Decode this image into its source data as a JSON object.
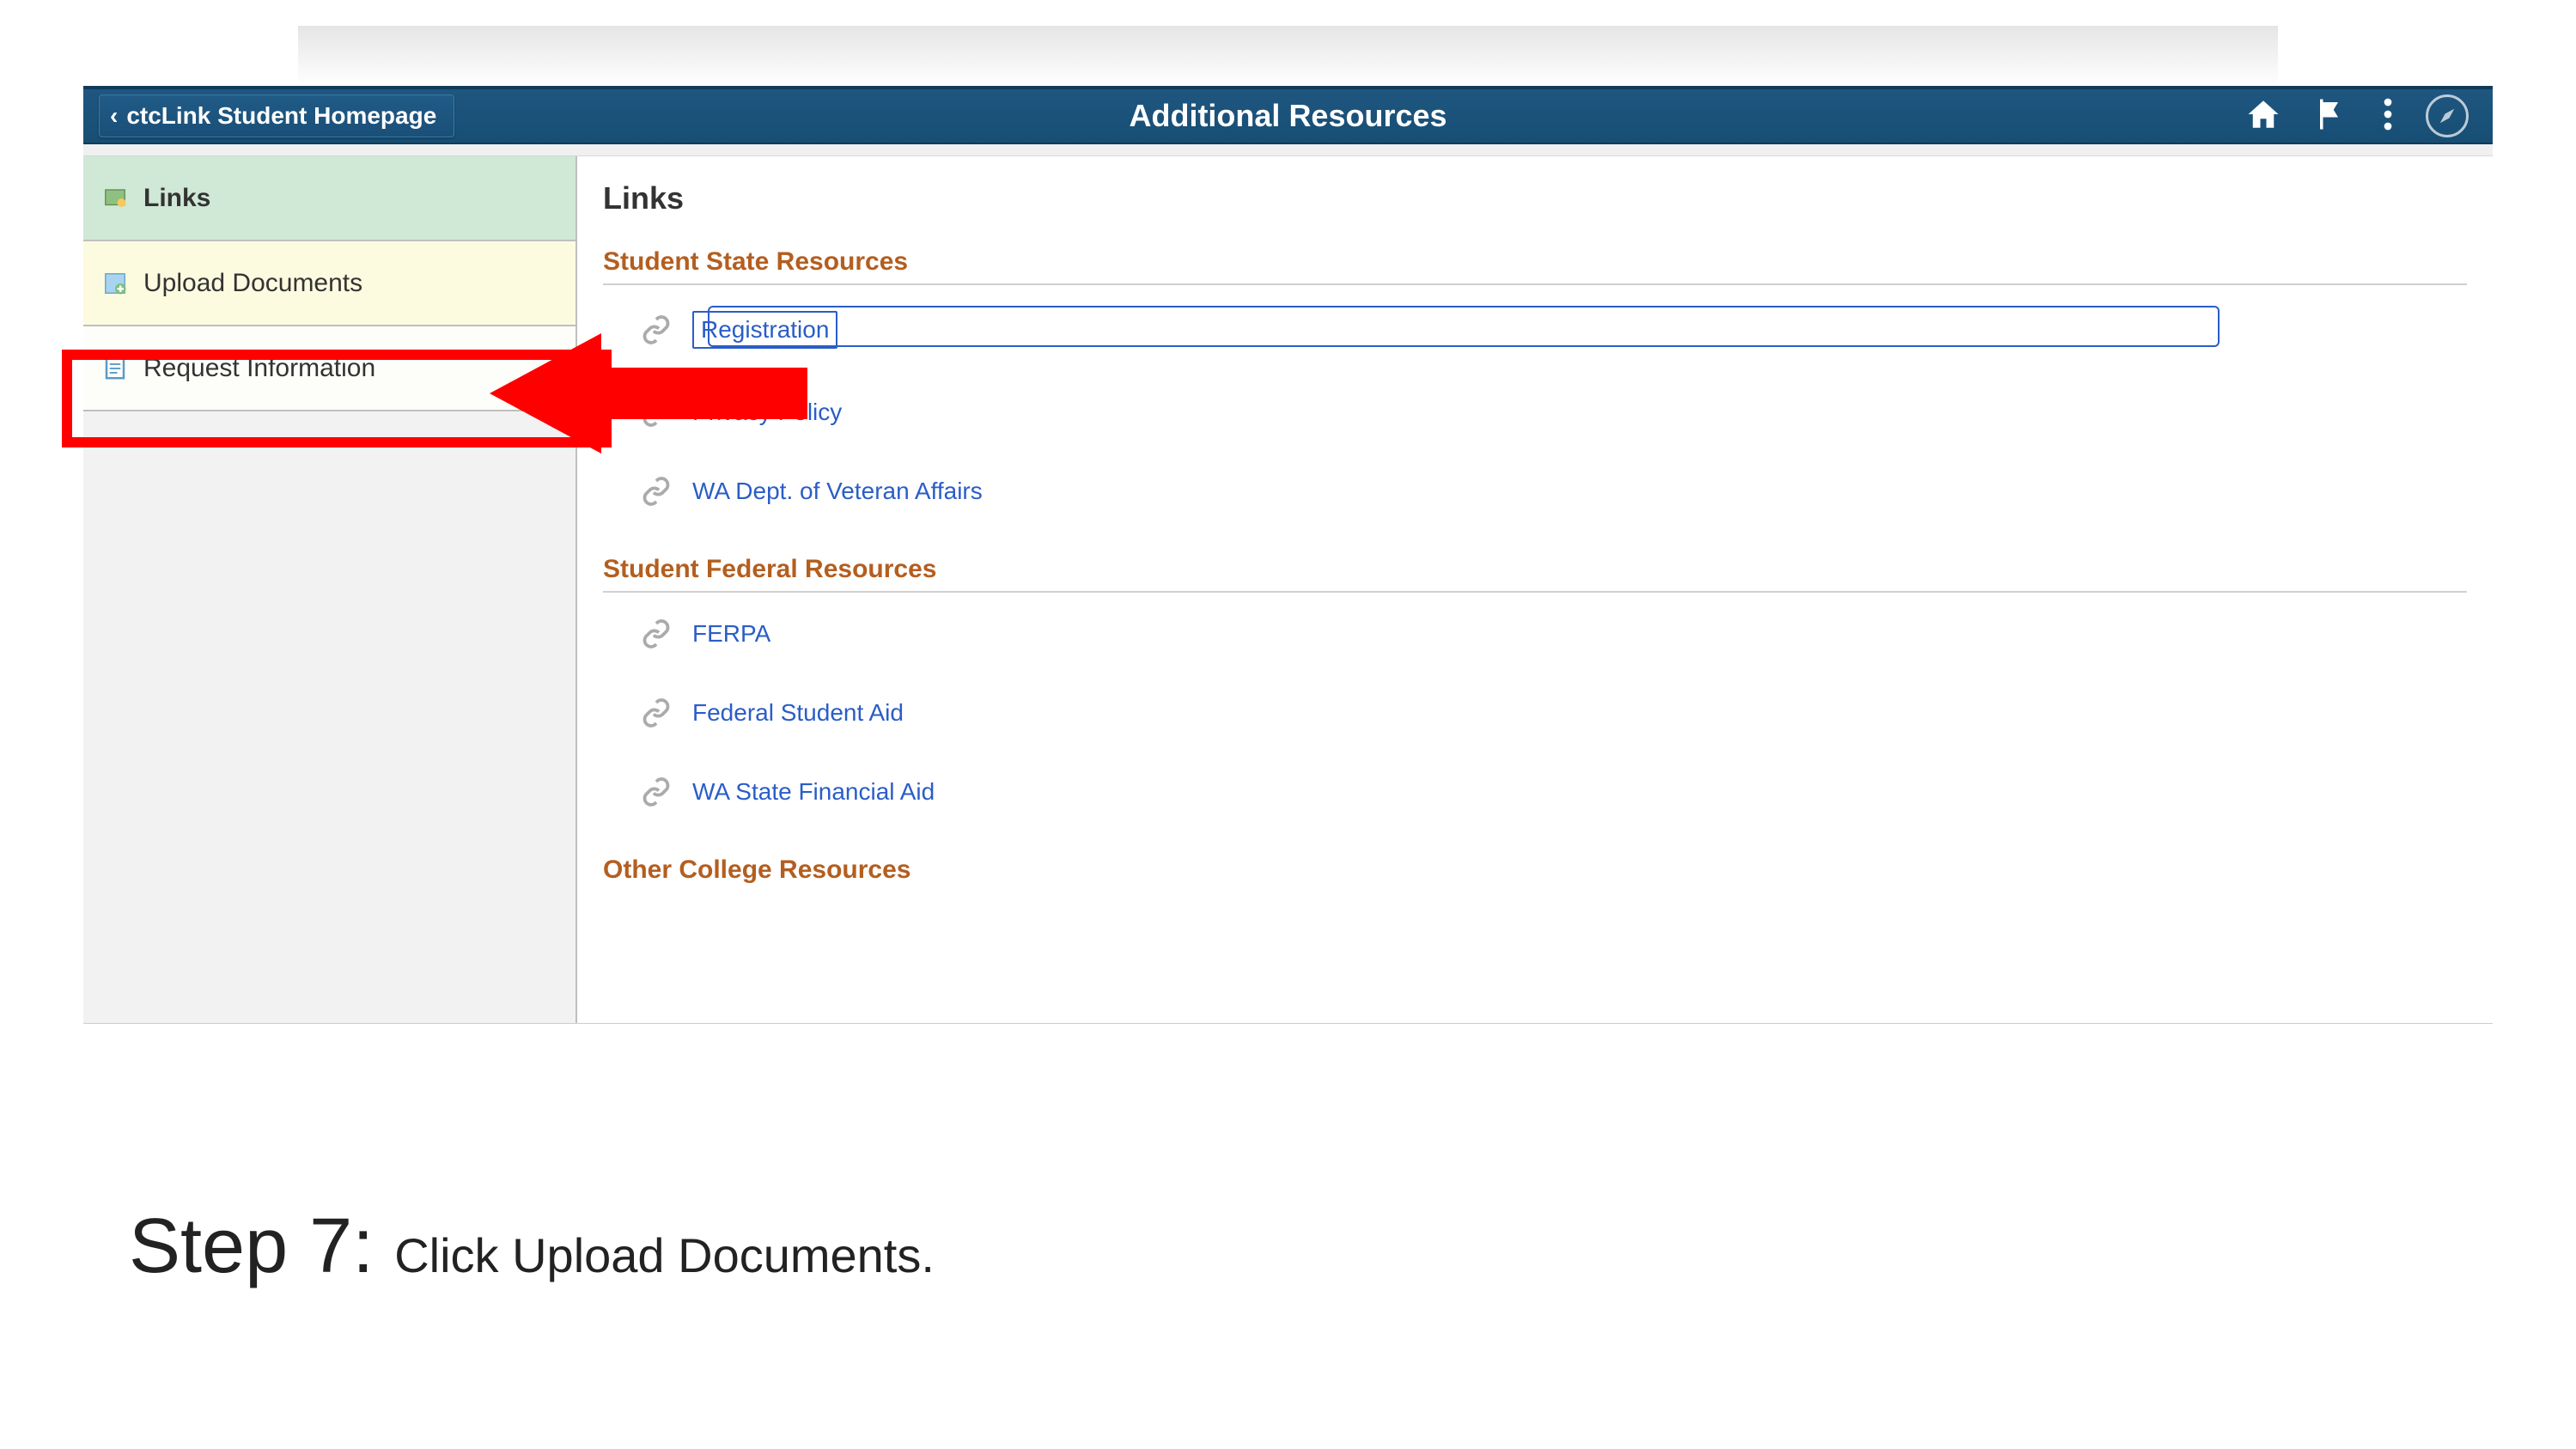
{
  "header": {
    "back_label": "ctcLink Student Homepage",
    "title": "Additional Resources"
  },
  "sidebar": {
    "items": [
      {
        "label": "Links",
        "icon": "links-icon",
        "active": true
      },
      {
        "label": "Upload Documents",
        "icon": "upload-icon",
        "highlighted": true
      },
      {
        "label": "Request Information",
        "icon": "request-icon"
      }
    ]
  },
  "main": {
    "title": "Links",
    "sections": [
      {
        "title": "Student State Resources",
        "links": [
          {
            "label": "Registration",
            "selected": true
          },
          {
            "label": "Privacy Policy"
          },
          {
            "label": "WA Dept. of Veteran Affairs"
          }
        ]
      },
      {
        "title": "Student Federal Resources",
        "links": [
          {
            "label": "FERPA"
          },
          {
            "label": "Federal Student Aid"
          },
          {
            "label": "WA State Financial Aid"
          }
        ]
      },
      {
        "title": "Other College Resources",
        "partial": true,
        "links": []
      }
    ]
  },
  "annotation": {
    "step_label": "Step 7:",
    "step_desc": "Click Upload Documents."
  }
}
